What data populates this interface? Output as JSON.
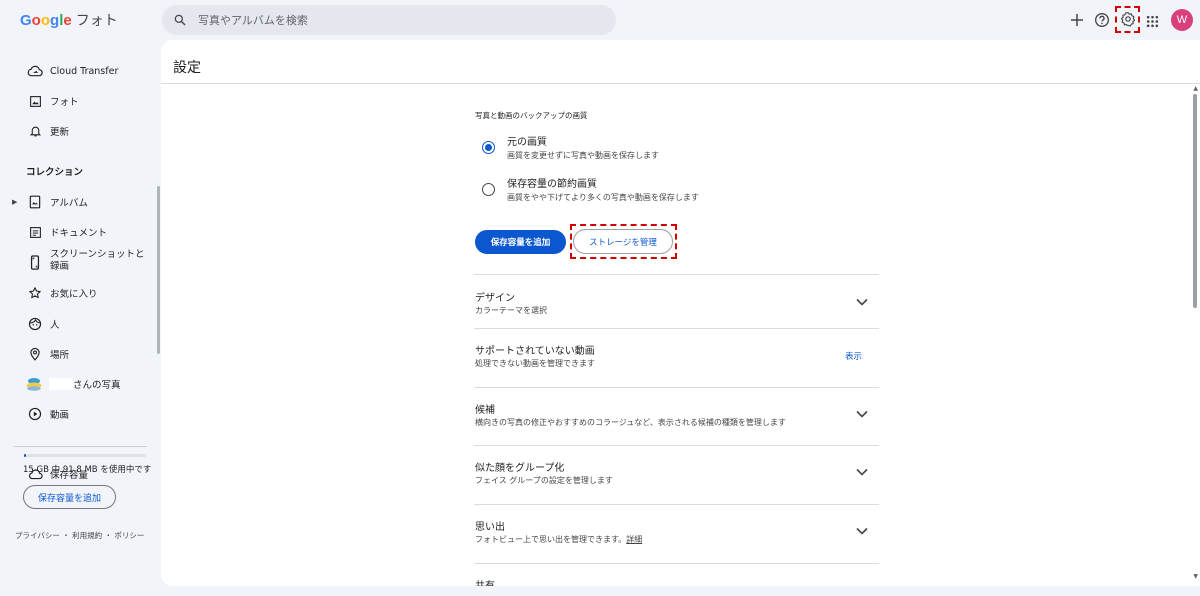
{
  "app": {
    "logo_text": "Google",
    "logo_suffix": "フォト"
  },
  "search": {
    "placeholder": "写真やアルバムを検索"
  },
  "header": {
    "add_icon": "plus-icon",
    "help_icon": "help-circle-icon",
    "settings_icon": "gear-icon",
    "apps_icon": "apps-grid-icon",
    "avatar_letter": "W",
    "avatar_color": "#d93f7a"
  },
  "sidebar": {
    "items": [
      {
        "label": "Cloud Transfer",
        "icon": "cloud-transfer-icon"
      },
      {
        "label": "フォト",
        "icon": "photo-icon"
      },
      {
        "label": "更新",
        "icon": "bell-icon"
      }
    ],
    "collection_title": "コレクション",
    "collection_items": [
      {
        "label": "アルバム",
        "icon": "album-icon"
      },
      {
        "label": "ドキュメント",
        "icon": "document-icon"
      },
      {
        "label": "スクリーンショットと録画",
        "label_line1": "スクリーンショットと",
        "label_line2": "録画",
        "icon": "phone-screenshot-icon"
      },
      {
        "label": "お気に入り",
        "icon": "star-icon"
      },
      {
        "label": "人",
        "icon": "face-icon"
      },
      {
        "label": "場所",
        "icon": "place-pin-icon"
      },
      {
        "label": "さんの写真",
        "icon": "shared-avatar-icon"
      },
      {
        "label": "動画",
        "icon": "play-circle-icon"
      }
    ],
    "storage": {
      "label": "保存容量",
      "icon": "cloud-icon",
      "usage_text": "15 GB 中 91.8 MB を使用中です",
      "usage_fraction": 0.006,
      "add_button": "保存容量を追加"
    },
    "footer": {
      "privacy": "プライバシー",
      "terms": "利用規約",
      "policy": "ポリシー",
      "separator": "・"
    }
  },
  "main": {
    "title": "設定",
    "backup_section_label": "写真と動画のバックアップの画質",
    "quality_options": [
      {
        "title": "元の画質",
        "subtitle": "画質を変更せずに写真や動画を保存します",
        "selected": true
      },
      {
        "title": "保存容量の節約画質",
        "subtitle": "画質をやや下げてより多くの写真や動画を保存します",
        "selected": false
      }
    ],
    "buttons": {
      "add_storage": "保存容量を追加",
      "manage_storage": "ストレージを管理"
    },
    "settings": [
      {
        "title": "デザイン",
        "subtitle": "カラーテーマを選択",
        "control": "chevron"
      },
      {
        "title": "サポートされていない動画",
        "subtitle": "処理できない動画を管理できます",
        "control": "link",
        "link_label": "表示"
      },
      {
        "title": "候補",
        "subtitle": "横向きの写真の修正やおすすめのコラージュなど、表示される候補の種類を管理します",
        "control": "chevron"
      },
      {
        "title": "似た顔をグループ化",
        "subtitle": "フェイス グループの設定を管理します",
        "control": "chevron"
      },
      {
        "title": "思い出",
        "subtitle": "フォトビュー上で思い出を管理できます。",
        "subtitle_link": "詳細",
        "control": "chevron"
      },
      {
        "title": "共有",
        "control": "chevron"
      }
    ]
  },
  "colors": {
    "accent": "#0b57d0",
    "highlight": "#d20000",
    "background": "#f1f4f9"
  }
}
